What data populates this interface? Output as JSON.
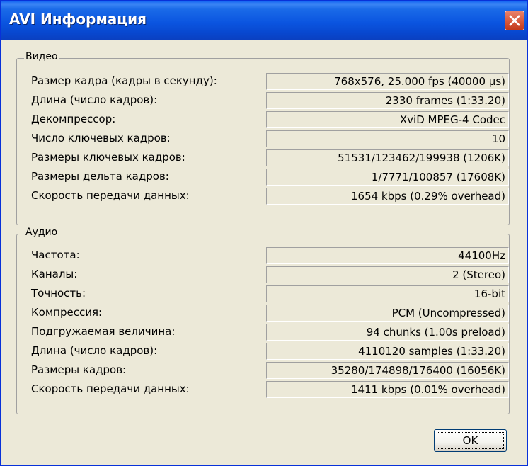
{
  "window": {
    "title": "AVI Информация",
    "close_icon": "close-x-icon"
  },
  "video": {
    "group_label": "Видео",
    "rows": [
      {
        "label": "Размер кадра (кадры в секунду):",
        "value": "768x576, 25.000 fps (40000 µs)"
      },
      {
        "label": "Длина (число кадров):",
        "value": "2330 frames (1:33.20)"
      },
      {
        "label": "Декомпрессор:",
        "value": "XviD MPEG-4 Codec"
      },
      {
        "label": "Число ключевых кадров:",
        "value": "10"
      },
      {
        "label": "Размеры ключевых кадров:",
        "value": "51531/123462/199938 (1206K)"
      },
      {
        "label": "Размеры дельта кадров:",
        "value": "1/7771/100857 (17608K)"
      },
      {
        "label": "Скорость передачи данных:",
        "value": "1654 kbps (0.29% overhead)"
      }
    ]
  },
  "audio": {
    "group_label": "Аудио",
    "rows": [
      {
        "label": "Частота:",
        "value": "44100Hz"
      },
      {
        "label": "Каналы:",
        "value": "2 (Stereo)"
      },
      {
        "label": "Точность:",
        "value": "16-bit"
      },
      {
        "label": "Компрессия:",
        "value": "PCM (Uncompressed)"
      },
      {
        "label": "Подгружаемая величина:",
        "value": "94 chunks (1.00s preload)"
      },
      {
        "label": "Длина (число кадров):",
        "value": "4110120 samples (1:33.20)"
      },
      {
        "label": "Размеры кадров:",
        "value": "35280/174898/176400 (16056K)"
      },
      {
        "label": "Скорость передачи данных:",
        "value": "1411 kbps (0.01% overhead)"
      }
    ]
  },
  "footer": {
    "ok_label": "OK"
  },
  "colors": {
    "titlebar": "#0a5cf1",
    "window_bg": "#ece9d8",
    "close_button": "#d85b3f"
  }
}
